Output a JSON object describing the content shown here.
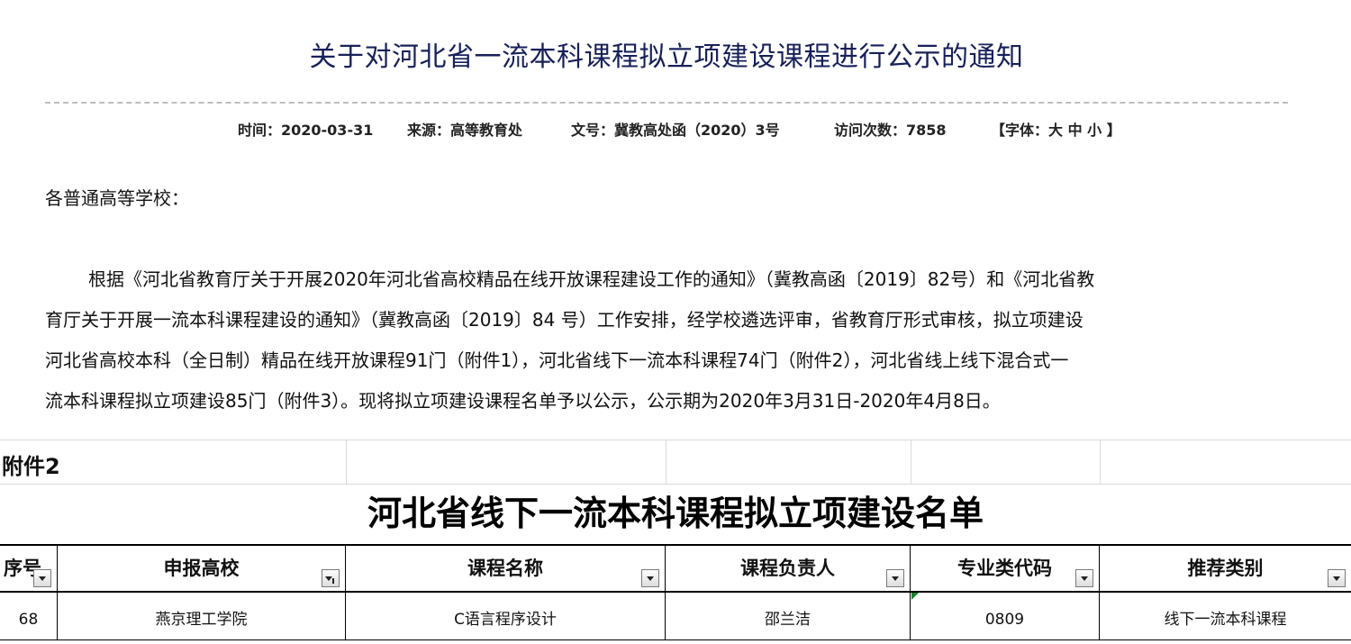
{
  "notice": {
    "title": "关于对河北省一流本科课程拟立项建设课程进行公示的通知",
    "meta": {
      "time": "时间：2020-03-31",
      "source": "来源：高等教育处",
      "doc_no": "文号：冀教高处函（2020）3号",
      "visits": "访问次数：7858",
      "font_size": "【字体：大 中 小 】"
    },
    "salutation": "各普通高等学校：",
    "body_lines": [
      "根据《河北省教育厅关于开展2020年河北省高校精品在线开放课程建设工作的通知》（冀教高函〔2019〕82号）和《河北省教",
      "育厅关于开展一流本科课程建设的通知》（冀教高函〔2019〕84 号）工作安排，经学校遴选评审，省教育厅形式审核，拟立项建设",
      "河北省高校本科（全日制）精品在线开放课程91门（附件1），河北省线下一流本科课程74门（附件2），河北省线上线下混合式一",
      "流本科课程拟立项建设85门（附件3）。现将拟立项建设课程名单予以公示，公示期为2020年3月31日-2020年4月8日。"
    ]
  },
  "sheet": {
    "attachment_label": "附件2",
    "list_title": "河北省线下一流本科课程拟立项建设名单",
    "headers": [
      "序号",
      "申报高校",
      "课程名称",
      "课程负责人",
      "专业类代码",
      "推荐类别"
    ],
    "rows": [
      [
        "68",
        "燕京理工学院",
        "C语言程序设计",
        "邵兰洁",
        "0809",
        "线下一流本科课程"
      ]
    ],
    "icons": {
      "filter": "dropdown-filter-icon",
      "filter_active": "filter-applied-icon"
    },
    "colors": {
      "title": "#17205a",
      "cell_comment_marker": "#1a7f2e"
    }
  }
}
